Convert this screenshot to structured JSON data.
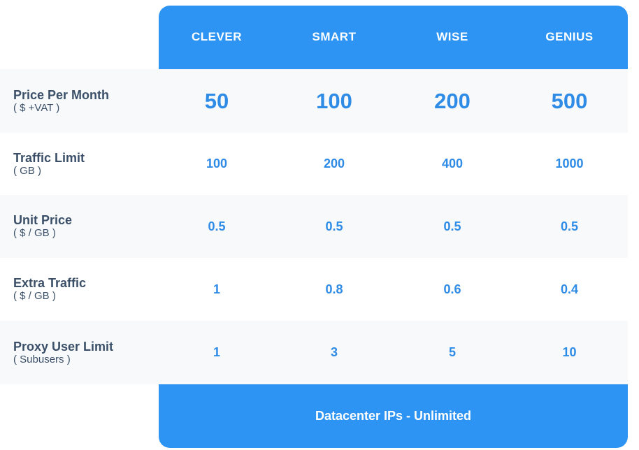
{
  "plans": [
    "CLEVER",
    "SMART",
    "WISE",
    "GENIUS"
  ],
  "rows": [
    {
      "title": "Price Per Month",
      "sub": "( $ +VAT )",
      "values": [
        "50",
        "100",
        "200",
        "500"
      ]
    },
    {
      "title": "Traffic Limit",
      "sub": "( GB )",
      "values": [
        "100",
        "200",
        "400",
        "1000"
      ]
    },
    {
      "title": "Unit Price",
      "sub": "( $ / GB )",
      "values": [
        "0.5",
        "0.5",
        "0.5",
        "0.5"
      ]
    },
    {
      "title": "Extra Traffic",
      "sub": "(  $ / GB )",
      "values": [
        "1",
        "0.8",
        "0.6",
        "0.4"
      ]
    },
    {
      "title": "Proxy User Limit",
      "sub": "( Subusers )",
      "values": [
        "1",
        "3",
        "5",
        "10"
      ]
    }
  ],
  "footer": "Datacenter IPs - Unlimited",
  "colors": {
    "accent": "#2e94f3",
    "value_text": "#2e8be6",
    "label_text": "#3b5068",
    "row_shade": "#f7f9fb"
  }
}
